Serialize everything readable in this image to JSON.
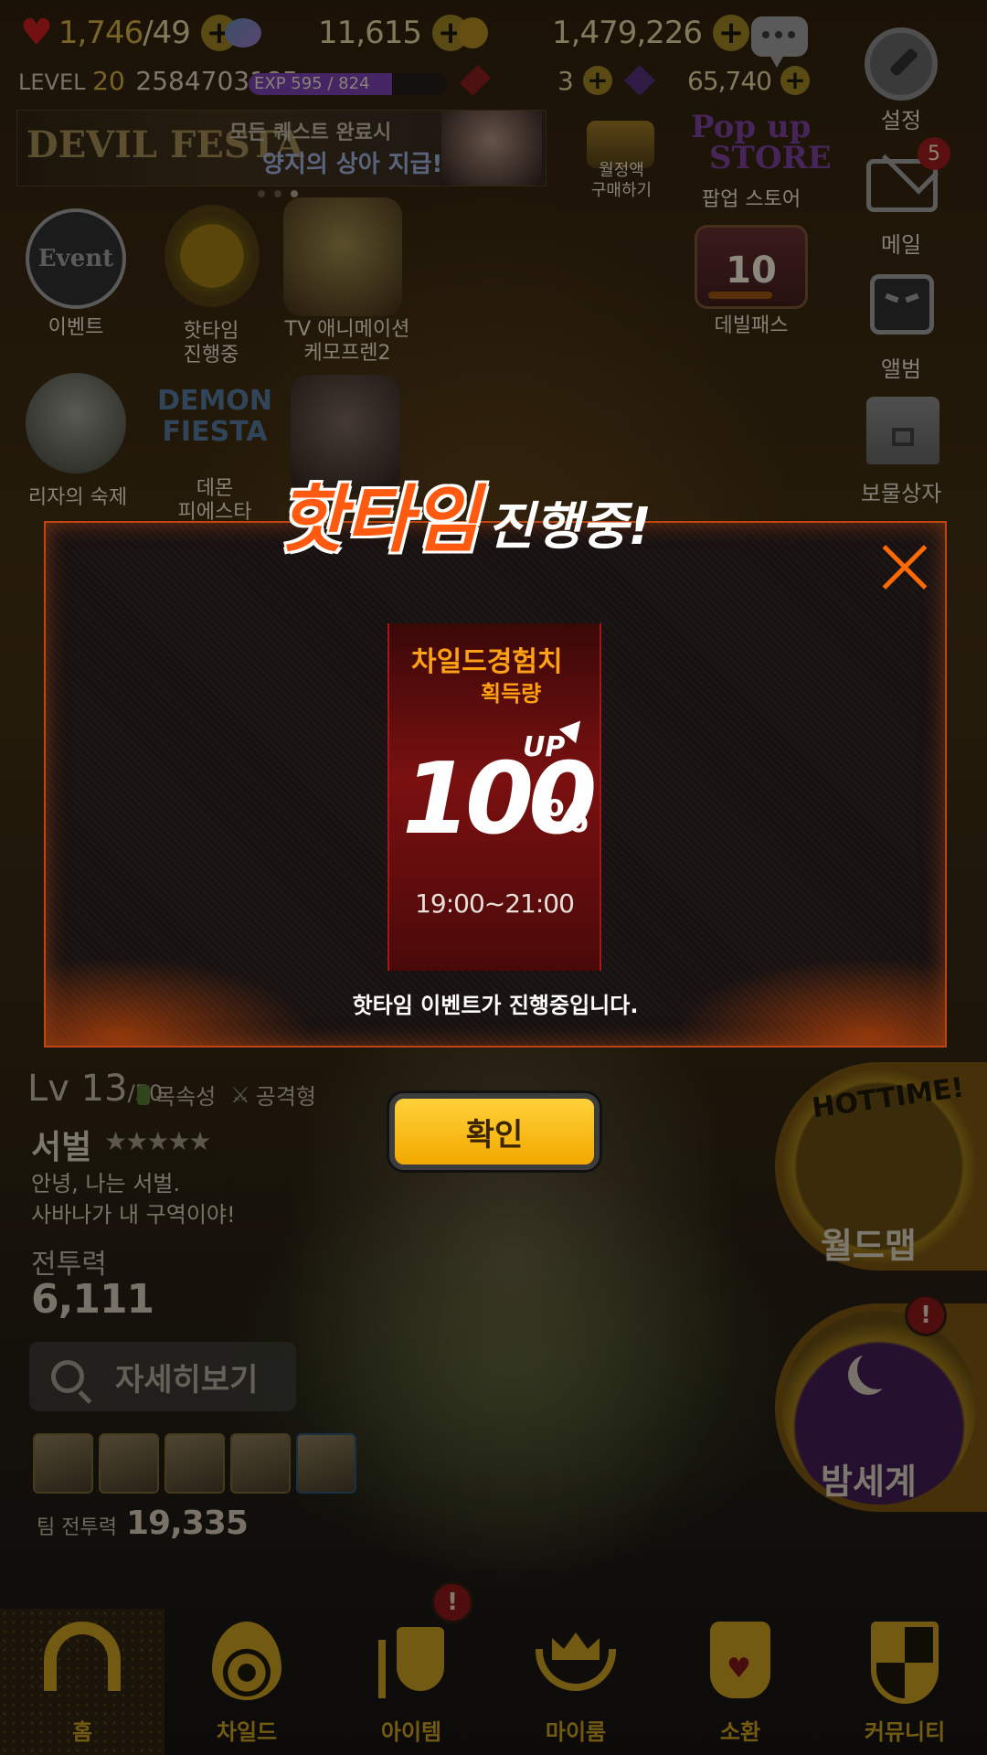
{
  "top_bar": {
    "stamina": "1,746",
    "stamina_max": "/49",
    "crystals": "11,615",
    "gold": "1,479,226",
    "level_label": "LEVEL",
    "level_value": "20",
    "user_id": "2584703185",
    "exp_text": "EXP 595 / 824",
    "exp_progress": 0.72,
    "red_gem": "3",
    "purple_gem": "65,740"
  },
  "banner": {
    "title": "DEVIL FESTA",
    "line1": "모든 퀘스트 완료시",
    "line2": "양지의 상아 지급!!"
  },
  "right_menu": {
    "settings": "설정",
    "mail": "메일",
    "mail_badge": "5",
    "album": "앨범",
    "treasure": "보물상자"
  },
  "shortcuts": {
    "monthly": "월정액\n구매하기",
    "popup_store": "팝업 스토어",
    "devil_pass": "데빌패스",
    "devil_pass_level": "10"
  },
  "event_grid": [
    {
      "label": "이벤트"
    },
    {
      "label": "핫타임\n진행중"
    },
    {
      "label": "TV 애니메이션\n케모프렌2"
    },
    {
      "label": "리자의 숙제"
    },
    {
      "label": "데몬\n피에스타"
    }
  ],
  "modal": {
    "title_main": "핫타임",
    "title_sub": "진행중!",
    "card_line1": "차일드경험치",
    "card_line2": "획득량",
    "card_up": "UP",
    "card_value": "100",
    "card_percent": "%",
    "card_time": "19:00~21:00",
    "message": "핫타임 이벤트가 진행중입니다.",
    "confirm": "확인"
  },
  "character": {
    "level": "Lv 13",
    "level_max": "/50",
    "element": "목속성",
    "type": "공격형",
    "name": "서벌",
    "stars": "★★★★★",
    "quote_line1": "안녕, 나는 서벌.",
    "quote_line2": "사바나가 내 구역이야!",
    "power_label": "전투력",
    "power_value": "6,111",
    "detail_button": "자세히보기",
    "team_power_label": "팀 전투력",
    "team_power_value": "19,335"
  },
  "side_buttons": {
    "world_map": "월드맵",
    "hottime_badge": "HOTTIME!",
    "night_world": "밤세계",
    "alert": "!"
  },
  "bottom_nav": {
    "items": [
      {
        "label": "홈"
      },
      {
        "label": "차일드"
      },
      {
        "label": "아이템"
      },
      {
        "label": "마이룸"
      },
      {
        "label": "소환"
      },
      {
        "label": "커뮤니티"
      }
    ],
    "item_alert": "!"
  },
  "colors": {
    "accent_orange": "#ff6a00",
    "confirm_yellow": "#ffc000",
    "alert_red": "#c0181b"
  }
}
